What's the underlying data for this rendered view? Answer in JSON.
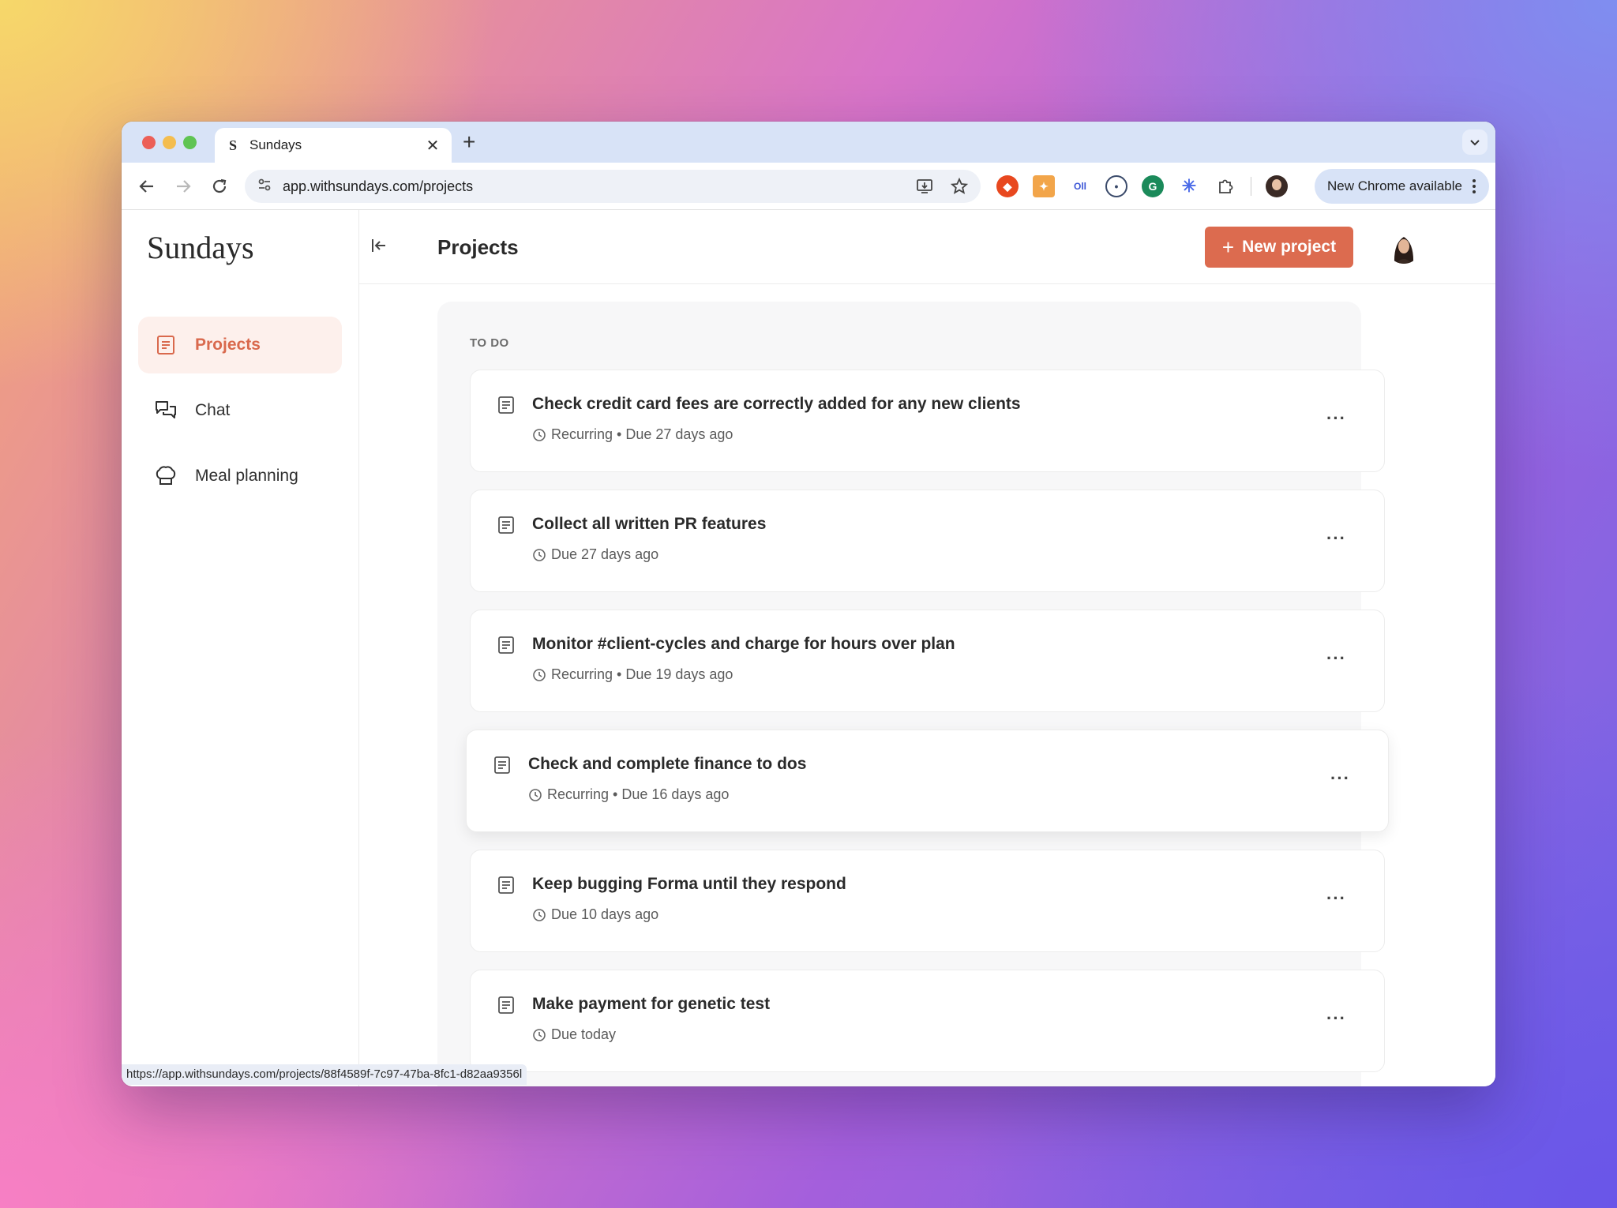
{
  "browser": {
    "tab_title": "Sundays",
    "tab_favicon": "S",
    "tab_close": "✕",
    "new_tab": "+",
    "url": "app.withsundays.com/projects",
    "update_label": "New Chrome available",
    "status_url": "https://app.withsundays.com/projects/88f4589f-7c97-47ba-8fc1-d82aa9356l",
    "extensions": [
      "ublock-icon",
      "metamask-icon",
      "otter-icon",
      "password-icon",
      "grammarly-icon",
      "perplexity-icon",
      "puzzle-icon"
    ]
  },
  "sidebar": {
    "brand": "Sundays",
    "items": [
      {
        "label": "Projects",
        "icon": "document-icon",
        "active": true
      },
      {
        "label": "Chat",
        "icon": "chat-icon",
        "active": false
      },
      {
        "label": "Meal planning",
        "icon": "chef-hat-icon",
        "active": false
      }
    ]
  },
  "header": {
    "title": "Projects",
    "new_project_label": "New project",
    "new_project_icon": "+"
  },
  "board": {
    "section_label": "TO DO",
    "cards": [
      {
        "title": "Check credit card fees are correctly added for any new clients",
        "meta": "Recurring • Due 27 days ago"
      },
      {
        "title": "Collect all written PR features",
        "meta": "Due 27 days ago"
      },
      {
        "title": "Monitor #client-cycles and charge for hours over plan",
        "meta": "Recurring • Due 19 days ago"
      },
      {
        "title": "Check and complete finance to dos",
        "meta": "Recurring • Due 16 days ago"
      },
      {
        "title": "Keep bugging Forma until they respond",
        "meta": "Due 10 days ago"
      },
      {
        "title": "Make payment for genetic test",
        "meta": "Due today"
      }
    ],
    "card_menu": "···"
  },
  "colors": {
    "accent": "#dc6b4f",
    "active_bg": "#fdf0ec"
  }
}
